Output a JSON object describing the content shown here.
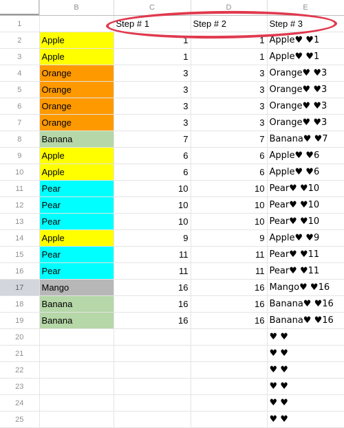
{
  "app": {
    "type": "spreadsheet",
    "corner_select_all": "select-all"
  },
  "columns": {
    "row_header": "",
    "letters": [
      "B",
      "C",
      "D",
      "E"
    ]
  },
  "annotation": {
    "shape": "ellipse",
    "color": "#e03a4e",
    "encircles": "header row cells C1:E1"
  },
  "colors": {
    "apple": "#FFFF00",
    "orange": "#FF9900",
    "banana": "#B6D7A8",
    "pear": "#00FFFF",
    "mango": "#B7B7B7",
    "empty": "#FFFFFF",
    "grid_line": "#E4E4E4",
    "header_text": "#8F8F8F",
    "annotation_red": "#E03A4E"
  },
  "rows": [
    {
      "n": "1",
      "b": "",
      "c": "Step # 1",
      "d": "Step # 2",
      "e": "Step # 3",
      "fill": "empty",
      "header_row": true
    },
    {
      "n": "2",
      "b": "Apple",
      "c": "1",
      "d": "1",
      "e": "Apple♥ ♥1",
      "fill": "apple"
    },
    {
      "n": "3",
      "b": "Apple",
      "c": "1",
      "d": "1",
      "e": "Apple♥ ♥1",
      "fill": "apple"
    },
    {
      "n": "4",
      "b": "Orange",
      "c": "3",
      "d": "3",
      "e": "Orange♥ ♥3",
      "fill": "orange"
    },
    {
      "n": "5",
      "b": "Orange",
      "c": "3",
      "d": "3",
      "e": "Orange♥ ♥3",
      "fill": "orange"
    },
    {
      "n": "6",
      "b": "Orange",
      "c": "3",
      "d": "3",
      "e": "Orange♥ ♥3",
      "fill": "orange"
    },
    {
      "n": "7",
      "b": "Orange",
      "c": "3",
      "d": "3",
      "e": "Orange♥ ♥3",
      "fill": "orange"
    },
    {
      "n": "8",
      "b": "Banana",
      "c": "7",
      "d": "7",
      "e": "Banana♥ ♥7",
      "fill": "banana"
    },
    {
      "n": "9",
      "b": "Apple",
      "c": "6",
      "d": "6",
      "e": "Apple♥ ♥6",
      "fill": "apple"
    },
    {
      "n": "10",
      "b": "Apple",
      "c": "6",
      "d": "6",
      "e": "Apple♥ ♥6",
      "fill": "apple"
    },
    {
      "n": "11",
      "b": "Pear",
      "c": "10",
      "d": "10",
      "e": "Pear♥ ♥10",
      "fill": "pear"
    },
    {
      "n": "12",
      "b": "Pear",
      "c": "10",
      "d": "10",
      "e": "Pear♥ ♥10",
      "fill": "pear"
    },
    {
      "n": "13",
      "b": "Pear",
      "c": "10",
      "d": "10",
      "e": "Pear♥ ♥10",
      "fill": "pear"
    },
    {
      "n": "14",
      "b": "Apple",
      "c": "9",
      "d": "9",
      "e": "Apple♥ ♥9",
      "fill": "apple"
    },
    {
      "n": "15",
      "b": "Pear",
      "c": "11",
      "d": "11",
      "e": "Pear♥ ♥11",
      "fill": "pear"
    },
    {
      "n": "16",
      "b": "Pear",
      "c": "11",
      "d": "11",
      "e": "Pear♥ ♥11",
      "fill": "pear"
    },
    {
      "n": "17",
      "b": "Mango",
      "c": "16",
      "d": "16",
      "e": "Mango♥ ♥16",
      "fill": "mango",
      "row_header_selected": true
    },
    {
      "n": "18",
      "b": "Banana",
      "c": "16",
      "d": "16",
      "e": "Banana♥ ♥16",
      "fill": "banana"
    },
    {
      "n": "19",
      "b": "Banana",
      "c": "16",
      "d": "16",
      "e": "Banana♥ ♥16",
      "fill": "banana"
    },
    {
      "n": "20",
      "b": "",
      "c": "",
      "d": "",
      "e": "♥ ♥",
      "fill": "empty"
    },
    {
      "n": "21",
      "b": "",
      "c": "",
      "d": "",
      "e": "♥ ♥",
      "fill": "empty"
    },
    {
      "n": "22",
      "b": "",
      "c": "",
      "d": "",
      "e": "♥ ♥",
      "fill": "empty"
    },
    {
      "n": "23",
      "b": "",
      "c": "",
      "d": "",
      "e": "♥ ♥",
      "fill": "empty"
    },
    {
      "n": "24",
      "b": "",
      "c": "",
      "d": "",
      "e": "♥ ♥",
      "fill": "empty"
    },
    {
      "n": "25",
      "b": "",
      "c": "",
      "d": "",
      "e": "♥ ♥",
      "fill": "empty"
    }
  ]
}
